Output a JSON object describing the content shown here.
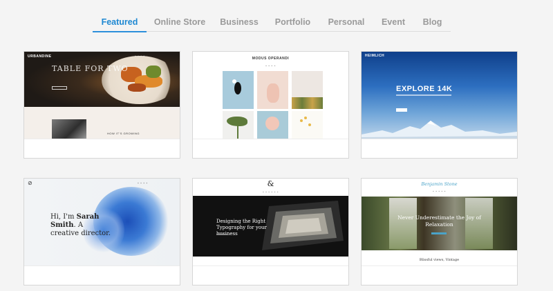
{
  "tabs": [
    {
      "label": "Featured",
      "active": true
    },
    {
      "label": "Online Store"
    },
    {
      "label": "Business"
    },
    {
      "label": "Portfolio"
    },
    {
      "label": "Personal"
    },
    {
      "label": "Event"
    },
    {
      "label": "Blog"
    }
  ],
  "colors": {
    "accent": "#1e88d2",
    "tab_inactive": "#9a9a9a",
    "background": "#f4f4f4"
  },
  "templates": [
    {
      "brand": "URBANDINE",
      "headline": "TABLE FOR TWO",
      "caption": "HOW IT'S GROWING"
    },
    {
      "brand": "MODUS OPERANDI"
    },
    {
      "brand": "HEIMLICH",
      "headline": "EXPLORE 14K"
    },
    {
      "headline_pre": "Hi, I'm ",
      "headline_name": "Sarah Smith",
      "headline_post": ". A creative director."
    },
    {
      "brand": "&",
      "headline": "Designing the Right Typography for your business"
    },
    {
      "brand": "Benjamin Stone",
      "headline": "Never Underestimate the Joy of Relaxation",
      "caption": "Blissful views, Vintage"
    }
  ]
}
